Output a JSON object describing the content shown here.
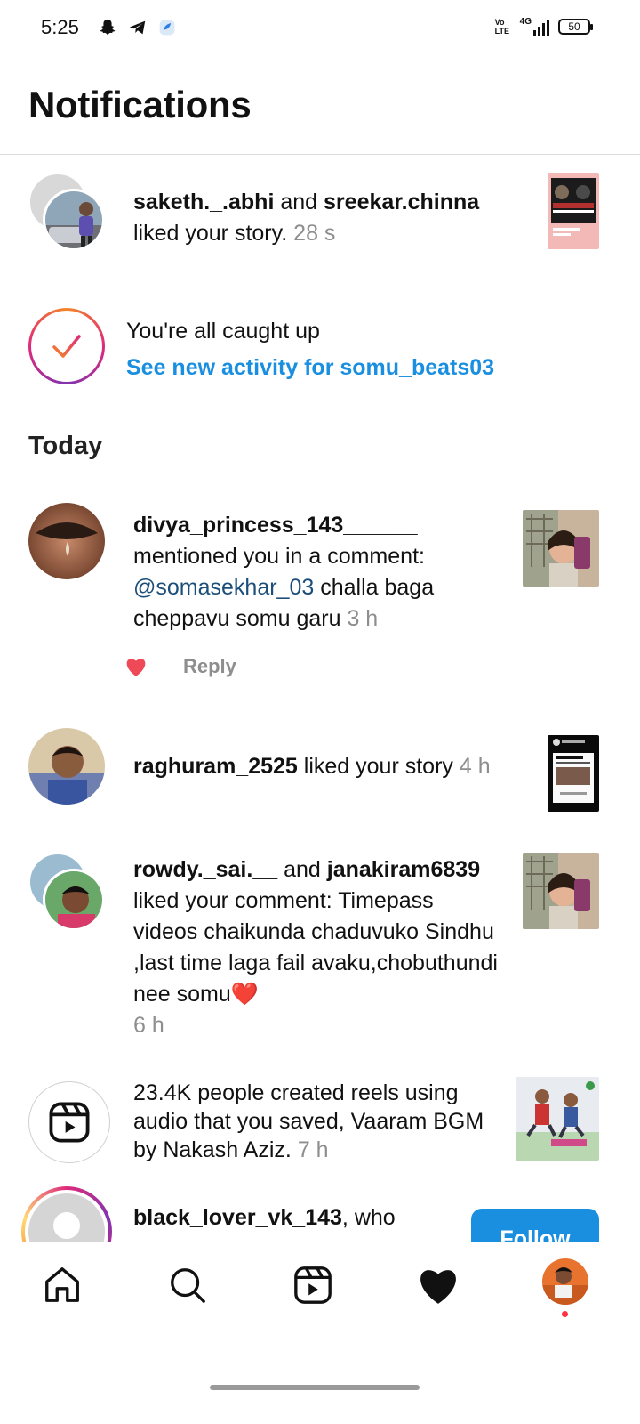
{
  "status_bar": {
    "time": "5:25",
    "network_label": "Vo LTE",
    "signal_label": "4G",
    "battery": "50"
  },
  "header": {
    "title": "Notifications"
  },
  "story_like": {
    "user1": "saketh._.abhi",
    "conjunction": "and",
    "user2": "sreekar.chinna",
    "action": "liked your story.",
    "time": "28 s"
  },
  "caught_up": {
    "title": "You're all caught up",
    "link": "See new activity for somu_beats03"
  },
  "section": {
    "today": "Today"
  },
  "mention": {
    "user": "divya_princess_143______",
    "action": "mentioned you in a comment:",
    "handle": "@somasekhar_03",
    "comment": "challa baga cheppavu somu garu",
    "time": "3 h",
    "reply_label": "Reply"
  },
  "story_like_2": {
    "user": "raghuram_2525",
    "action": "liked your story",
    "time": "4 h"
  },
  "comment_like": {
    "user1": "rowdy._sai.__",
    "conjunction": "and",
    "user2": "janakiram6839",
    "action": "liked your comment: Timepass videos chaikunda chaduvuko Sindhu ,last time laga fail avaku,chobuthundi nee somu",
    "emoji": "❤️",
    "time": "6 h"
  },
  "reels_audio": {
    "text": "23.4K people created reels using audio that you saved, Vaaram BGM by Nakash Aziz.",
    "time": "7 h"
  },
  "follow_suggestion": {
    "user": "black_lover_vk_143",
    "suffix": ", who",
    "follow_label": "Follow"
  },
  "nav": {
    "home": "home-icon",
    "search": "search-icon",
    "reels": "reels-icon",
    "activity": "heart-icon",
    "profile": "profile-avatar"
  },
  "colors": {
    "accent_blue": "#1a8fe0",
    "heart_red": "#ed4956",
    "muted": "#8e8e8e",
    "mention_blue": "#1c4e7a"
  }
}
